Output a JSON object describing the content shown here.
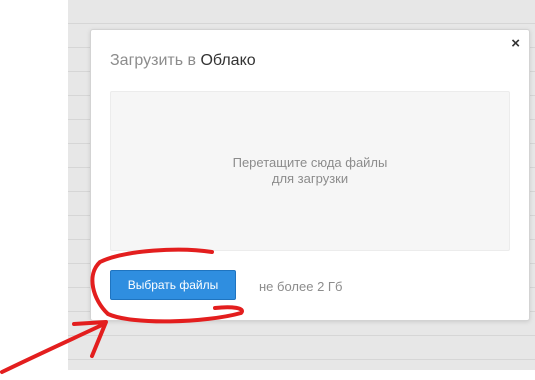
{
  "dialog": {
    "title_prefix": "Загрузить в",
    "title_brand": "Облако",
    "close_glyph": "×",
    "dropzone_text": "Перетащите сюда файлы\nдля загрузки",
    "upload_button_label": "Выбрать файлы",
    "size_limit": "не более 2 Гб"
  },
  "colors": {
    "button": "#2f8ee0",
    "annotation": "#e31e1e"
  }
}
